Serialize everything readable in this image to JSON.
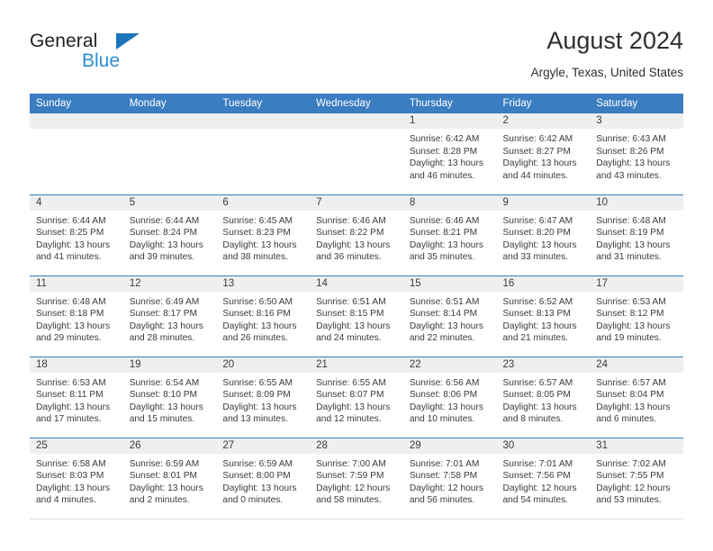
{
  "brand": {
    "name_part1": "General",
    "name_part2": "Blue",
    "accent_color": "#1b75bb",
    "logo_icon": "triangle-icon"
  },
  "header": {
    "title": "August 2024",
    "location": "Argyle, Texas, United States"
  },
  "theme": {
    "header_blue": "#3a7dc0",
    "daynum_gray": "#efefef",
    "text_dark": "#3b3b3b"
  },
  "calendar": {
    "weekday_headers": [
      "Sunday",
      "Monday",
      "Tuesday",
      "Wednesday",
      "Thursday",
      "Friday",
      "Saturday"
    ],
    "weeks": [
      [
        {
          "day": "",
          "empty": true
        },
        {
          "day": "",
          "empty": true
        },
        {
          "day": "",
          "empty": true
        },
        {
          "day": "",
          "empty": true
        },
        {
          "day": "1",
          "sunrise": "Sunrise: 6:42 AM",
          "sunset": "Sunset: 8:28 PM",
          "daylight1": "Daylight: 13 hours",
          "daylight2": "and 46 minutes."
        },
        {
          "day": "2",
          "sunrise": "Sunrise: 6:42 AM",
          "sunset": "Sunset: 8:27 PM",
          "daylight1": "Daylight: 13 hours",
          "daylight2": "and 44 minutes."
        },
        {
          "day": "3",
          "sunrise": "Sunrise: 6:43 AM",
          "sunset": "Sunset: 8:26 PM",
          "daylight1": "Daylight: 13 hours",
          "daylight2": "and 43 minutes."
        }
      ],
      [
        {
          "day": "4",
          "sunrise": "Sunrise: 6:44 AM",
          "sunset": "Sunset: 8:25 PM",
          "daylight1": "Daylight: 13 hours",
          "daylight2": "and 41 minutes."
        },
        {
          "day": "5",
          "sunrise": "Sunrise: 6:44 AM",
          "sunset": "Sunset: 8:24 PM",
          "daylight1": "Daylight: 13 hours",
          "daylight2": "and 39 minutes."
        },
        {
          "day": "6",
          "sunrise": "Sunrise: 6:45 AM",
          "sunset": "Sunset: 8:23 PM",
          "daylight1": "Daylight: 13 hours",
          "daylight2": "and 38 minutes."
        },
        {
          "day": "7",
          "sunrise": "Sunrise: 6:46 AM",
          "sunset": "Sunset: 8:22 PM",
          "daylight1": "Daylight: 13 hours",
          "daylight2": "and 36 minutes."
        },
        {
          "day": "8",
          "sunrise": "Sunrise: 6:46 AM",
          "sunset": "Sunset: 8:21 PM",
          "daylight1": "Daylight: 13 hours",
          "daylight2": "and 35 minutes."
        },
        {
          "day": "9",
          "sunrise": "Sunrise: 6:47 AM",
          "sunset": "Sunset: 8:20 PM",
          "daylight1": "Daylight: 13 hours",
          "daylight2": "and 33 minutes."
        },
        {
          "day": "10",
          "sunrise": "Sunrise: 6:48 AM",
          "sunset": "Sunset: 8:19 PM",
          "daylight1": "Daylight: 13 hours",
          "daylight2": "and 31 minutes."
        }
      ],
      [
        {
          "day": "11",
          "sunrise": "Sunrise: 6:48 AM",
          "sunset": "Sunset: 8:18 PM",
          "daylight1": "Daylight: 13 hours",
          "daylight2": "and 29 minutes."
        },
        {
          "day": "12",
          "sunrise": "Sunrise: 6:49 AM",
          "sunset": "Sunset: 8:17 PM",
          "daylight1": "Daylight: 13 hours",
          "daylight2": "and 28 minutes."
        },
        {
          "day": "13",
          "sunrise": "Sunrise: 6:50 AM",
          "sunset": "Sunset: 8:16 PM",
          "daylight1": "Daylight: 13 hours",
          "daylight2": "and 26 minutes."
        },
        {
          "day": "14",
          "sunrise": "Sunrise: 6:51 AM",
          "sunset": "Sunset: 8:15 PM",
          "daylight1": "Daylight: 13 hours",
          "daylight2": "and 24 minutes."
        },
        {
          "day": "15",
          "sunrise": "Sunrise: 6:51 AM",
          "sunset": "Sunset: 8:14 PM",
          "daylight1": "Daylight: 13 hours",
          "daylight2": "and 22 minutes."
        },
        {
          "day": "16",
          "sunrise": "Sunrise: 6:52 AM",
          "sunset": "Sunset: 8:13 PM",
          "daylight1": "Daylight: 13 hours",
          "daylight2": "and 21 minutes."
        },
        {
          "day": "17",
          "sunrise": "Sunrise: 6:53 AM",
          "sunset": "Sunset: 8:12 PM",
          "daylight1": "Daylight: 13 hours",
          "daylight2": "and 19 minutes."
        }
      ],
      [
        {
          "day": "18",
          "sunrise": "Sunrise: 6:53 AM",
          "sunset": "Sunset: 8:11 PM",
          "daylight1": "Daylight: 13 hours",
          "daylight2": "and 17 minutes."
        },
        {
          "day": "19",
          "sunrise": "Sunrise: 6:54 AM",
          "sunset": "Sunset: 8:10 PM",
          "daylight1": "Daylight: 13 hours",
          "daylight2": "and 15 minutes."
        },
        {
          "day": "20",
          "sunrise": "Sunrise: 6:55 AM",
          "sunset": "Sunset: 8:09 PM",
          "daylight1": "Daylight: 13 hours",
          "daylight2": "and 13 minutes."
        },
        {
          "day": "21",
          "sunrise": "Sunrise: 6:55 AM",
          "sunset": "Sunset: 8:07 PM",
          "daylight1": "Daylight: 13 hours",
          "daylight2": "and 12 minutes."
        },
        {
          "day": "22",
          "sunrise": "Sunrise: 6:56 AM",
          "sunset": "Sunset: 8:06 PM",
          "daylight1": "Daylight: 13 hours",
          "daylight2": "and 10 minutes."
        },
        {
          "day": "23",
          "sunrise": "Sunrise: 6:57 AM",
          "sunset": "Sunset: 8:05 PM",
          "daylight1": "Daylight: 13 hours",
          "daylight2": "and 8 minutes."
        },
        {
          "day": "24",
          "sunrise": "Sunrise: 6:57 AM",
          "sunset": "Sunset: 8:04 PM",
          "daylight1": "Daylight: 13 hours",
          "daylight2": "and 6 minutes."
        }
      ],
      [
        {
          "day": "25",
          "sunrise": "Sunrise: 6:58 AM",
          "sunset": "Sunset: 8:03 PM",
          "daylight1": "Daylight: 13 hours",
          "daylight2": "and 4 minutes."
        },
        {
          "day": "26",
          "sunrise": "Sunrise: 6:59 AM",
          "sunset": "Sunset: 8:01 PM",
          "daylight1": "Daylight: 13 hours",
          "daylight2": "and 2 minutes."
        },
        {
          "day": "27",
          "sunrise": "Sunrise: 6:59 AM",
          "sunset": "Sunset: 8:00 PM",
          "daylight1": "Daylight: 13 hours",
          "daylight2": "and 0 minutes."
        },
        {
          "day": "28",
          "sunrise": "Sunrise: 7:00 AM",
          "sunset": "Sunset: 7:59 PM",
          "daylight1": "Daylight: 12 hours",
          "daylight2": "and 58 minutes."
        },
        {
          "day": "29",
          "sunrise": "Sunrise: 7:01 AM",
          "sunset": "Sunset: 7:58 PM",
          "daylight1": "Daylight: 12 hours",
          "daylight2": "and 56 minutes."
        },
        {
          "day": "30",
          "sunrise": "Sunrise: 7:01 AM",
          "sunset": "Sunset: 7:56 PM",
          "daylight1": "Daylight: 12 hours",
          "daylight2": "and 54 minutes."
        },
        {
          "day": "31",
          "sunrise": "Sunrise: 7:02 AM",
          "sunset": "Sunset: 7:55 PM",
          "daylight1": "Daylight: 12 hours",
          "daylight2": "and 53 minutes."
        }
      ]
    ]
  }
}
